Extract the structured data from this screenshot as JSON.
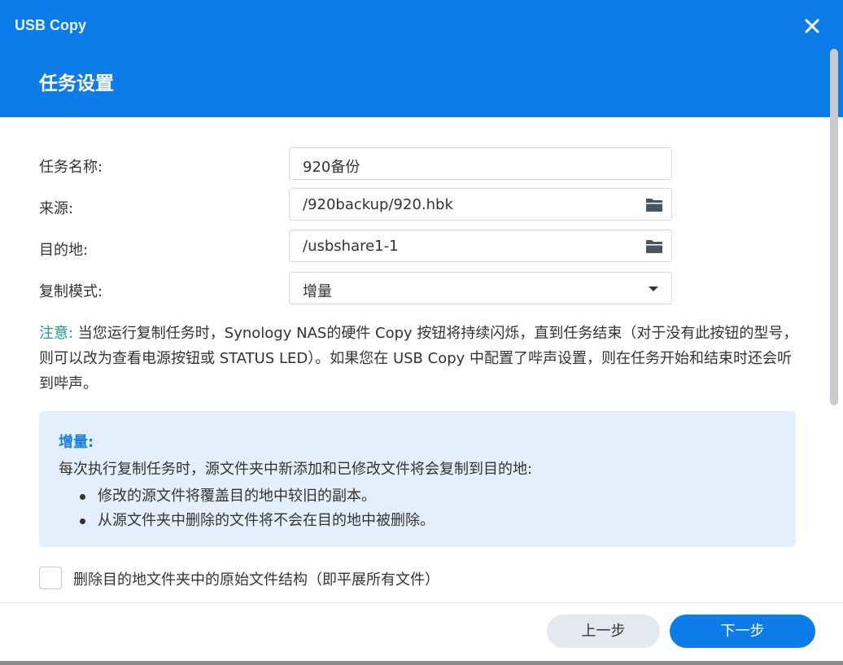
{
  "window": {
    "title": "USB Copy"
  },
  "header": {
    "page_title": "任务设置"
  },
  "form": {
    "task_name": {
      "label": "任务名称:",
      "value": "920备份"
    },
    "source": {
      "label": "来源:",
      "value": "/920backup/920.hbk"
    },
    "destination": {
      "label": "目的地:",
      "value": "/usbshare1-1"
    },
    "copy_mode": {
      "label": "复制模式:",
      "value": "增量"
    }
  },
  "note": {
    "label": "注意:",
    "text": " 当您运行复制任务时，Synology NAS的硬件 Copy 按钮将持续闪烁，直到任务结束（对于没有此按钮的型号，则可以改为查看电源按钮或 STATUS LED）。如果您在 USB Copy 中配置了哔声设置，则在任务开始和结束时还会听到哔声。"
  },
  "info_box": {
    "title": "增量:",
    "description": "每次执行复制任务时，源文件夹中新添加和已修改文件将会复制到目的地:",
    "bullets": [
      "修改的源文件将覆盖目的地中较旧的副本。",
      "从源文件夹中删除的文件将不会在目的地中被删除。"
    ]
  },
  "option": {
    "label": "删除目的地文件夹中的原始文件结构（即平展所有文件）",
    "checked": false
  },
  "footer": {
    "prev_label": "上一步",
    "next_label": "下一步"
  },
  "colors": {
    "accent": "#0b7ce8",
    "info_bg": "#e3f0fc",
    "note_label": "#1a9e8e"
  },
  "icons": {
    "close": "close-icon",
    "folder": "folder-icon",
    "dropdown": "chevron-down-icon"
  }
}
